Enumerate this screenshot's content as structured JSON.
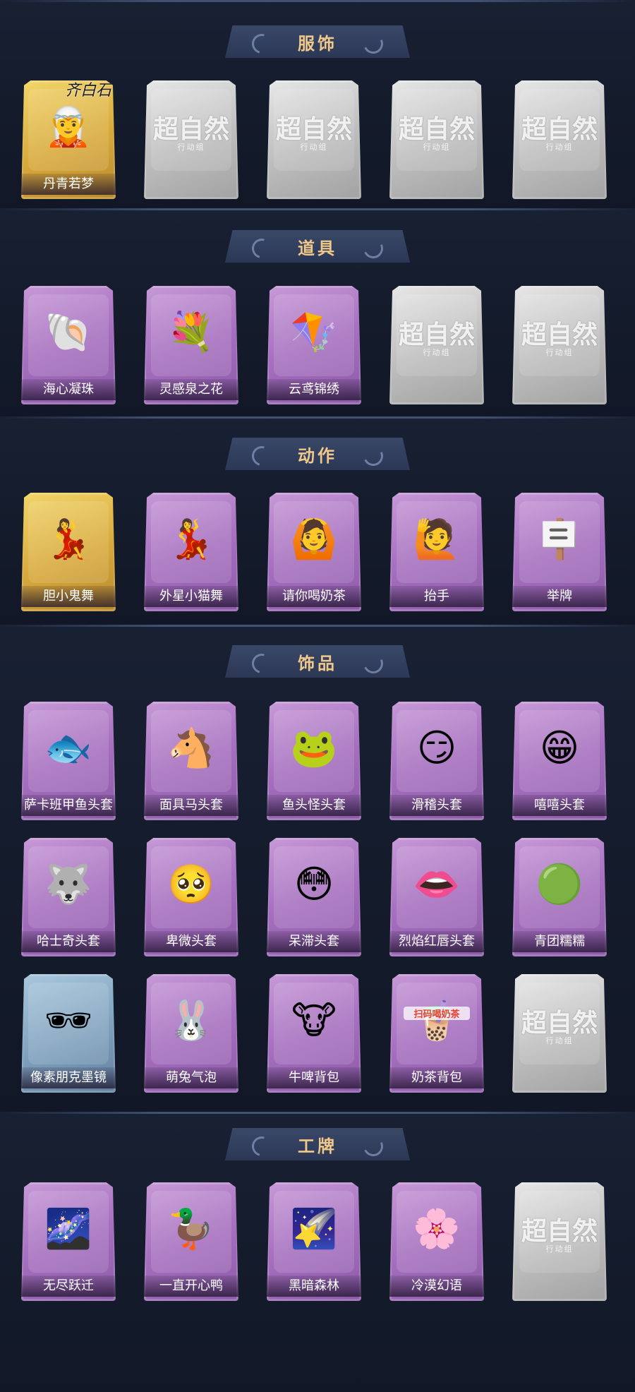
{
  "sections": [
    {
      "title": "服饰",
      "rows": [
        [
          {
            "label": "丹青若梦",
            "rarity": "gold",
            "icon": "character-icon",
            "badge": "齐白石"
          },
          {
            "watermark": "超自然",
            "watermark_sub": "行动组",
            "rarity": "grey",
            "icon": "locked-placeholder-icon"
          },
          {
            "watermark": "超自然",
            "watermark_sub": "行动组",
            "rarity": "grey",
            "icon": "locked-placeholder-icon"
          },
          {
            "watermark": "超自然",
            "watermark_sub": "行动组",
            "rarity": "grey",
            "icon": "locked-placeholder-icon"
          },
          {
            "watermark": "超自然",
            "watermark_sub": "行动组",
            "rarity": "grey",
            "icon": "locked-placeholder-icon"
          }
        ]
      ]
    },
    {
      "title": "道具",
      "rows": [
        [
          {
            "label": "海心凝珠",
            "rarity": "purple",
            "icon": "shell-pearl-icon"
          },
          {
            "label": "灵感泉之花",
            "rarity": "purple",
            "icon": "flower-bouquet-icon"
          },
          {
            "label": "云鸢锦绣",
            "rarity": "purple",
            "icon": "kite-icon"
          },
          {
            "watermark": "超自然",
            "watermark_sub": "行动组",
            "rarity": "grey",
            "icon": "locked-placeholder-icon"
          },
          {
            "watermark": "超自然",
            "watermark_sub": "行动组",
            "rarity": "grey",
            "icon": "locked-placeholder-icon"
          }
        ]
      ]
    },
    {
      "title": "动作",
      "rows": [
        [
          {
            "label": "胆小鬼舞",
            "rarity": "gold",
            "icon": "dance-pose-icon"
          },
          {
            "label": "外星小猫舞",
            "rarity": "purple",
            "icon": "dance-pose-icon"
          },
          {
            "label": "请你喝奶茶",
            "rarity": "purple",
            "icon": "sign-pose-icon"
          },
          {
            "label": "抬手",
            "rarity": "purple",
            "icon": "raise-hand-icon"
          },
          {
            "label": "举牌",
            "rarity": "purple",
            "icon": "hold-sign-icon"
          }
        ]
      ]
    },
    {
      "title": "饰品",
      "rows": [
        [
          {
            "label": "萨卡班甲鱼头套",
            "rarity": "purple",
            "icon": "fish-head-icon"
          },
          {
            "label": "面具马头套",
            "rarity": "purple",
            "icon": "horse-head-icon"
          },
          {
            "label": "鱼头怪头套",
            "rarity": "purple",
            "icon": "green-fish-head-icon"
          },
          {
            "label": "滑稽头套",
            "rarity": "purple",
            "icon": "smirk-emoji-icon"
          },
          {
            "label": "嘻嘻头套",
            "rarity": "purple",
            "icon": "grin-emoji-icon"
          }
        ],
        [
          {
            "label": "哈士奇头套",
            "rarity": "purple",
            "icon": "husky-head-icon"
          },
          {
            "label": "卑微头套",
            "rarity": "purple",
            "icon": "pleading-emoji-icon"
          },
          {
            "label": "呆滞头套",
            "rarity": "purple",
            "icon": "dazed-emoji-icon"
          },
          {
            "label": "烈焰红唇头套",
            "rarity": "purple",
            "icon": "red-lips-head-icon"
          },
          {
            "label": "青团糯糯",
            "rarity": "purple",
            "icon": "green-dumpling-icon"
          }
        ],
        [
          {
            "label": "像素朋克墨镜",
            "rarity": "blue",
            "icon": "pixel-sunglasses-icon"
          },
          {
            "label": "萌兔气泡",
            "rarity": "purple",
            "icon": "bunny-bubble-icon"
          },
          {
            "label": "牛啤背包",
            "rarity": "purple",
            "icon": "cow-barrel-backpack-icon"
          },
          {
            "label": "奶茶背包",
            "rarity": "purple",
            "icon": "milk-tea-backpack-icon",
            "art_text": "扫码喝奶茶"
          },
          {
            "watermark": "超自然",
            "watermark_sub": "行动组",
            "rarity": "grey",
            "icon": "locked-placeholder-icon"
          }
        ]
      ]
    },
    {
      "title": "工牌",
      "rows": [
        [
          {
            "label": "无尽跃迁",
            "rarity": "purple",
            "icon": "galaxy-card-icon"
          },
          {
            "label": "一直开心鸭",
            "rarity": "purple",
            "icon": "duck-card-icon"
          },
          {
            "label": "黑暗森林",
            "rarity": "purple",
            "icon": "dark-forest-card-icon"
          },
          {
            "label": "冷漠幻语",
            "rarity": "purple",
            "icon": "sky-card-icon"
          },
          {
            "watermark": "超自然",
            "watermark_sub": "行动组",
            "rarity": "grey",
            "icon": "locked-placeholder-icon"
          }
        ]
      ]
    }
  ],
  "colors": {
    "background": "#121826",
    "header_title": "#f0c98a",
    "gold": "#e0b447",
    "purple": "#a66fbf",
    "blue": "#7fa1bd",
    "grey": "#c4c4c4"
  }
}
